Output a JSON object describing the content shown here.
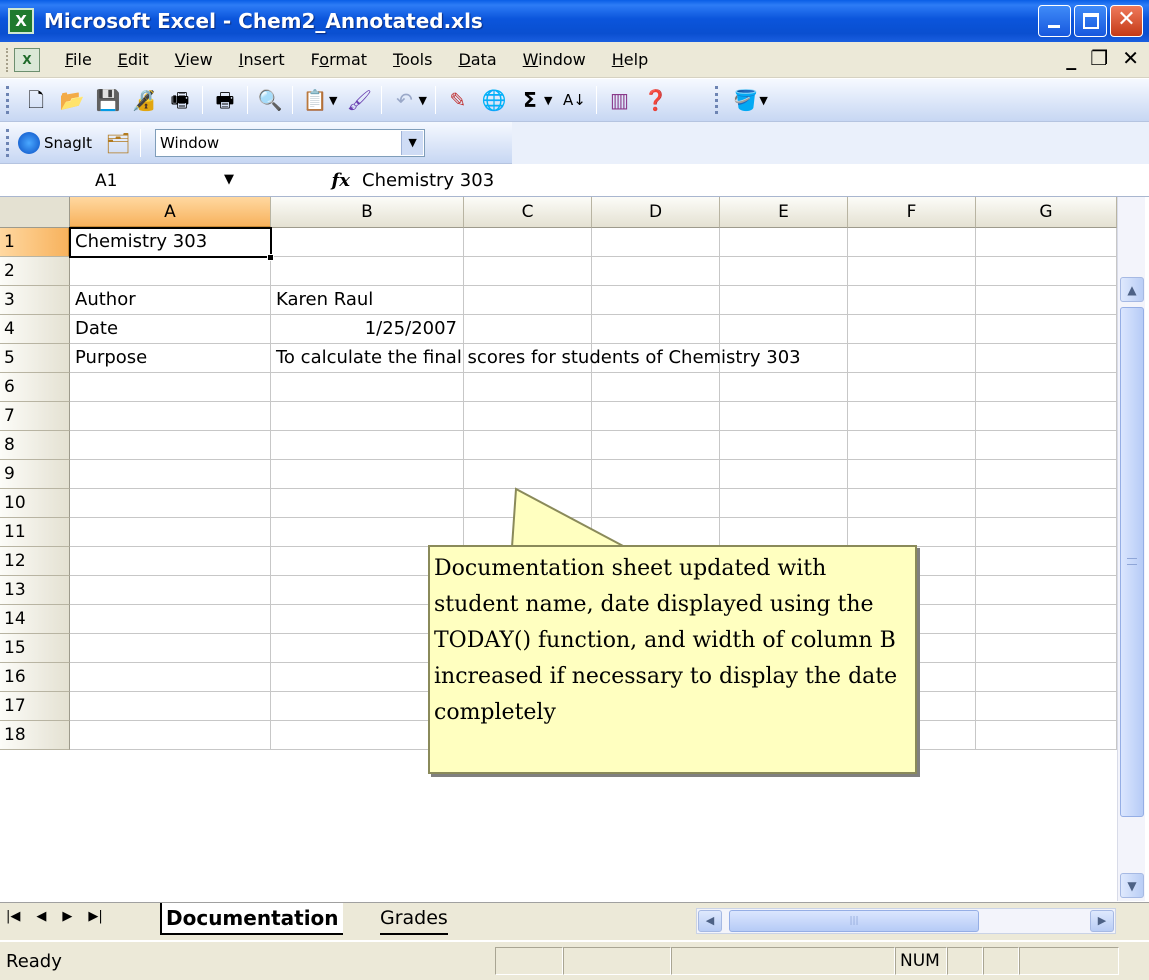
{
  "window": {
    "title": "Microsoft Excel - Chem2_Annotated.xls",
    "app_icon_glyph": "X"
  },
  "menu": {
    "items": [
      "File",
      "Edit",
      "View",
      "Insert",
      "Format",
      "Tools",
      "Data",
      "Window",
      "Help"
    ],
    "mnemonics": [
      "F",
      "E",
      "V",
      "I",
      "o",
      "T",
      "D",
      "W",
      "H"
    ]
  },
  "toolbar": {
    "icons": [
      "new-icon",
      "open-icon",
      "save-icon",
      "permission-icon",
      "print-preview-icon",
      "print-icon",
      "research-icon",
      "paste-icon",
      "format-painter-icon",
      "undo-icon",
      "draw-icon",
      "hyperlink-icon",
      "autosum-icon",
      "sort-ascending-icon",
      "chart-wizard-icon",
      "help-icon",
      "fill-color-icon"
    ]
  },
  "snagit": {
    "label": "SnagIt",
    "combo_value": "Window"
  },
  "formula_bar": {
    "name_box": "A1",
    "fx": "fx",
    "content": "Chemistry 303"
  },
  "columns": [
    "A",
    "B",
    "C",
    "D",
    "E",
    "F",
    "G"
  ],
  "rows": [
    "1",
    "2",
    "3",
    "4",
    "5",
    "6",
    "7",
    "8",
    "9",
    "10",
    "11",
    "12",
    "13",
    "14",
    "15",
    "16",
    "17",
    "18"
  ],
  "cells": {
    "A1": "Chemistry 303",
    "A3": "Author",
    "B3": "Karen Raul",
    "A4": "Date",
    "B4": "1/25/2007",
    "A5": "Purpose",
    "B5": "To calculate the final scores for students of Chemistry 303"
  },
  "comment": {
    "text": "Documentation sheet updated with student name, date displayed using the TODAY() function, and width of column B increased if necessary to display the date completely"
  },
  "sheets": {
    "active": "Documentation",
    "other": "Grades"
  },
  "status": {
    "left": "Ready",
    "num": "NUM"
  }
}
